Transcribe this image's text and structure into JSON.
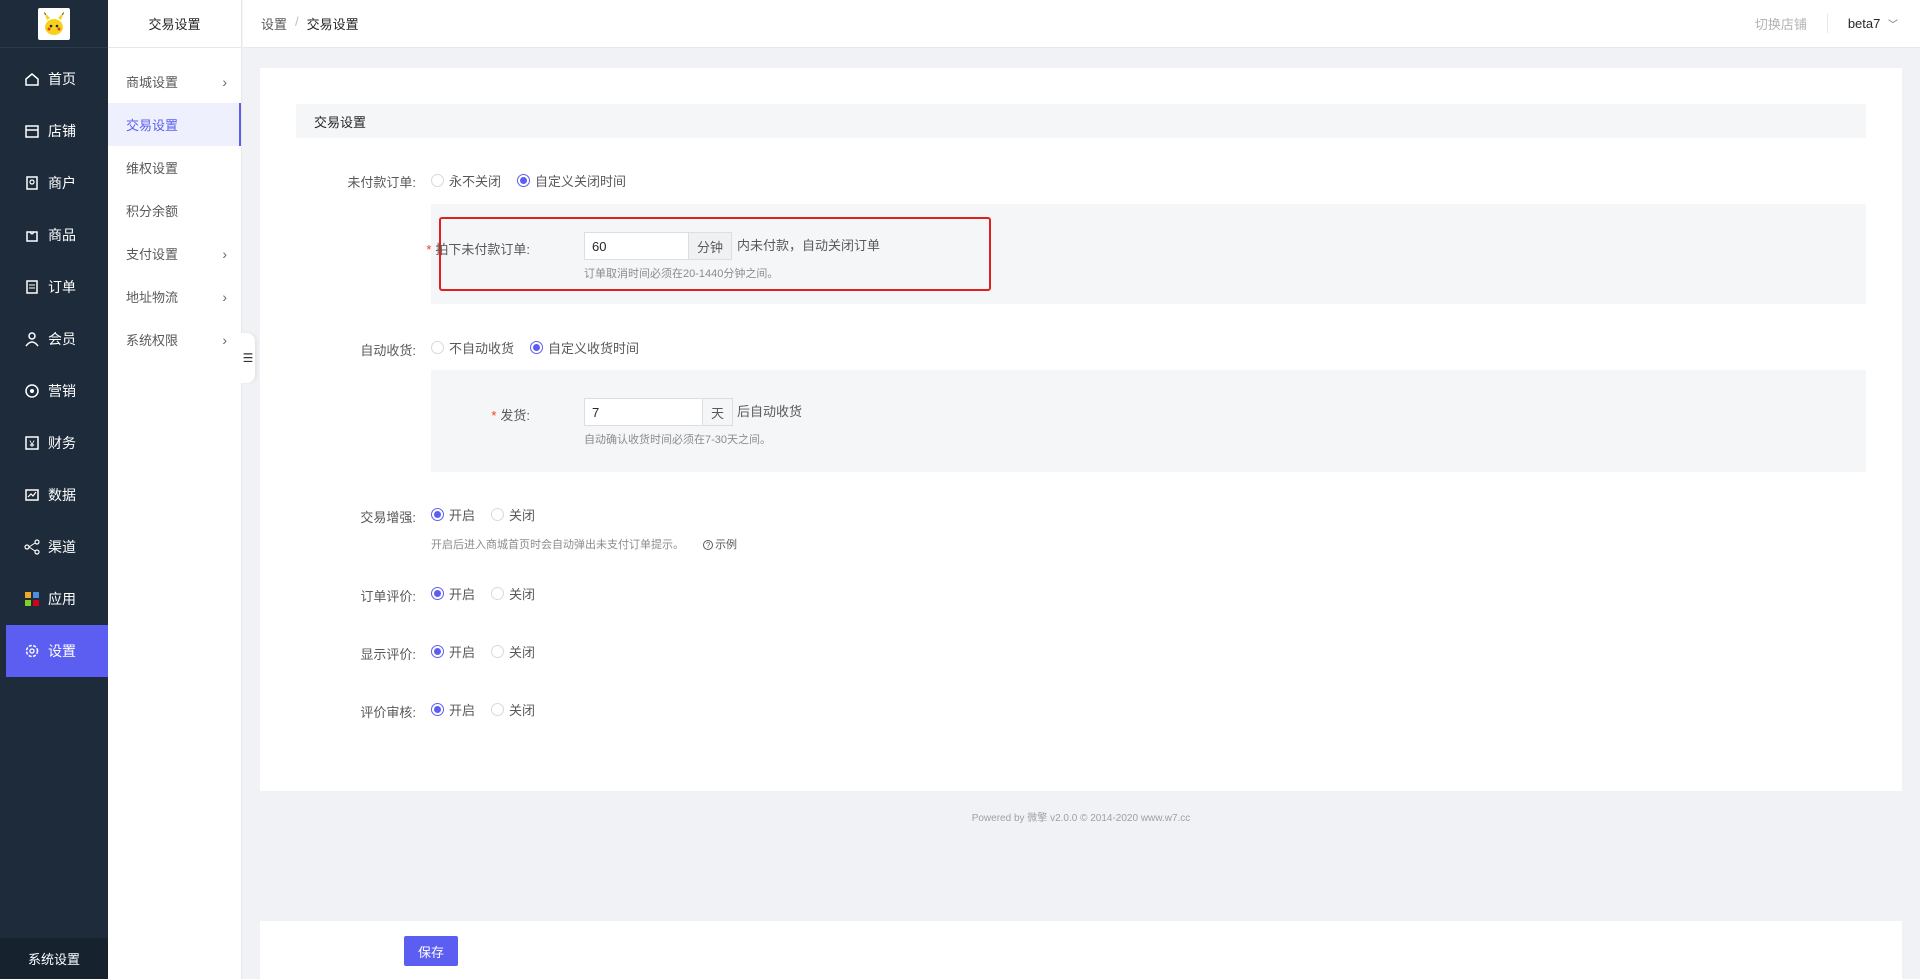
{
  "sidebar": {
    "logo_alt": "logo",
    "items": [
      {
        "label": "首页",
        "icon": "home-icon"
      },
      {
        "label": "店铺",
        "icon": "store-icon"
      },
      {
        "label": "商户",
        "icon": "merchant-icon"
      },
      {
        "label": "商品",
        "icon": "goods-icon"
      },
      {
        "label": "订单",
        "icon": "order-icon"
      },
      {
        "label": "会员",
        "icon": "member-icon"
      },
      {
        "label": "营销",
        "icon": "marketing-icon"
      },
      {
        "label": "财务",
        "icon": "finance-icon"
      },
      {
        "label": "数据",
        "icon": "data-icon"
      },
      {
        "label": "渠道",
        "icon": "channel-icon"
      },
      {
        "label": "应用",
        "icon": "apps-icon"
      },
      {
        "label": "设置",
        "icon": "settings-icon"
      }
    ],
    "active_index": 11,
    "footer": "系统设置",
    "accent": "#5c5ef2"
  },
  "subnav": {
    "title": "交易设置",
    "items": [
      {
        "label": "商城设置",
        "has_children": true
      },
      {
        "label": "交易设置",
        "has_children": false
      },
      {
        "label": "维权设置",
        "has_children": false
      },
      {
        "label": "积分余额",
        "has_children": false
      },
      {
        "label": "支付设置",
        "has_children": true
      },
      {
        "label": "地址物流",
        "has_children": true
      },
      {
        "label": "系统权限",
        "has_children": true
      }
    ],
    "active_index": 1
  },
  "topbar": {
    "breadcrumb": [
      "设置",
      "交易设置"
    ],
    "switch_store": "切换店铺",
    "user": "beta7"
  },
  "form": {
    "section_title": "交易设置",
    "unpaid": {
      "label": "未付款订单:",
      "options": [
        "永不关闭",
        "自定义关闭时间"
      ],
      "selected": 1,
      "field_label": "拍下未付款订单:",
      "value": "60",
      "unit": "分钟",
      "after": "内未付款，自动关闭订单",
      "hint": "订单取消时间必须在20-1440分钟之间。"
    },
    "auto_receive": {
      "label": "自动收货:",
      "options": [
        "不自动收货",
        "自定义收货时间"
      ],
      "selected": 1,
      "field_label": "发货:",
      "value": "7",
      "unit": "天",
      "after": "后自动收货",
      "hint": "自动确认收货时间必须在7-30天之间。"
    },
    "enhance": {
      "label": "交易增强:",
      "options": [
        "开启",
        "关闭"
      ],
      "selected": 0,
      "hint": "开启后进入商城首页时会自动弹出未支付订单提示。",
      "example": "示例"
    },
    "order_review": {
      "label": "订单评价:",
      "options": [
        "开启",
        "关闭"
      ],
      "selected": 0
    },
    "show_review": {
      "label": "显示评价:",
      "options": [
        "开启",
        "关闭"
      ],
      "selected": 0
    },
    "review_audit": {
      "label": "评价审核:",
      "options": [
        "开启",
        "关闭"
      ],
      "selected": 0
    }
  },
  "footer": "Powered by 微擎 v2.0.0 © 2014-2020 www.w7.cc",
  "save_label": "保存"
}
